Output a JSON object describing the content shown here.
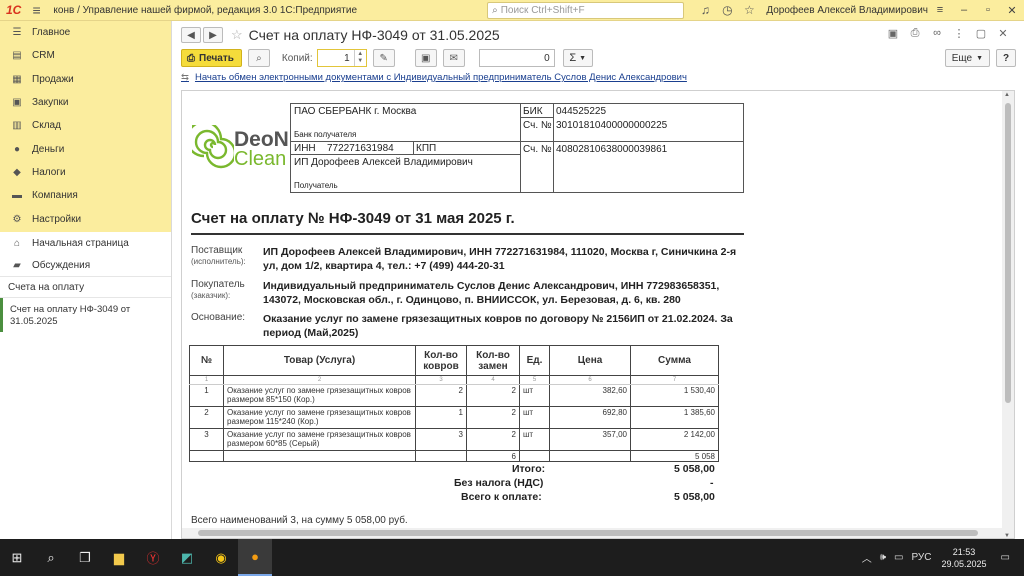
{
  "app": {
    "logo": "1С",
    "title": "конв / Управление нашей фирмой, редакция 3.0 1С:Предприятие",
    "search_placeholder": "Поиск Ctrl+Shift+F",
    "user": "Дорофеев Алексей Владимирович"
  },
  "sidebar": {
    "sections": [
      {
        "label": "Главное",
        "icon": "menu-icon"
      },
      {
        "label": "CRM",
        "icon": "crm-icon"
      },
      {
        "label": "Продажи",
        "icon": "sales-icon"
      },
      {
        "label": "Закупки",
        "icon": "purchases-icon"
      },
      {
        "label": "Склад",
        "icon": "warehouse-icon"
      },
      {
        "label": "Деньги",
        "icon": "money-icon"
      },
      {
        "label": "Налоги",
        "icon": "taxes-icon"
      },
      {
        "label": "Компания",
        "icon": "company-icon"
      },
      {
        "label": "Настройки",
        "icon": "settings-icon"
      }
    ],
    "home": "Начальная страница",
    "discussions": "Обсуждения",
    "group": "Счета на оплату",
    "open_doc": "Счет на оплату НФ-3049 от 31.05.2025"
  },
  "header": {
    "doc_title": "Счет на оплату НФ-3049 от 31.05.2025"
  },
  "toolbar": {
    "print_label": "Печать",
    "copies_label": "Копий:",
    "copies_value": "1",
    "number_value": "0",
    "sigma_label": "Σ",
    "more_label": "Еще",
    "help_label": "?"
  },
  "edo_link": "Начать обмен электронными документами с Индивидуальный предприниматель Суслов Денис Александрович",
  "logo": {
    "line1": "DeoN",
    "line2": "Clean"
  },
  "bank": {
    "bank_name": "ПАО СБЕРБАНК г. Москва",
    "bank_caption": "Банк получателя",
    "bik_label": "БИК",
    "bik_value": "044525225",
    "acc_label": "Сч. №",
    "corr_acc": "30101810400000000225",
    "inn_label": "ИНН",
    "inn_value": "772271631984",
    "kpp_label": "КПП",
    "recipient_name": "ИП Дорофеев Алексей Владимирович",
    "recipient_caption": "Получатель",
    "acc_label2": "Сч. №",
    "recipient_acc": "40802810638000039861"
  },
  "invoice_title": "Счет на оплату № НФ-3049 от 31 мая 2025 г.",
  "supplier": {
    "label": "Поставщик",
    "sub": "(исполнитель):",
    "value": "ИП Дорофеев Алексей Владимирович, ИНН 772271631984, 111020, Москва г, Синичкина 2-я ул, дом 1/2, квартира 4, тел.: +7 (499) 444-20-31"
  },
  "buyer": {
    "label": "Покупатель",
    "sub": "(заказчик):",
    "value": "Индивидуальный предприниматель Суслов Денис Александрович, ИНН 772983658351, 143072, Московская обл., г. Одинцово, п. ВНИИССОК, ул. Березовая, д. 6, кв. 280"
  },
  "basis": {
    "label": "Основание:",
    "value": "Оказание услуг по замене грязезащитных ковров по договору № 2156ИП от 21.02.2024. За период (Май,2025)"
  },
  "table": {
    "headers": [
      "№",
      "Товар (Услуга)",
      "Кол-во ковров",
      "Кол-во замен",
      "Ед.",
      "Цена",
      "Сумма"
    ],
    "col_numbers": [
      "1",
      "2",
      "3",
      "4",
      "5",
      "6",
      "7"
    ],
    "rows": [
      {
        "n": "1",
        "name": "Оказание услуг по замене грязезащитных ковров размером 85*150 (Кор.)",
        "qty": "2",
        "repl": "2",
        "unit": "шт",
        "price": "382,60",
        "sum": "1 530,40"
      },
      {
        "n": "2",
        "name": "Оказание услуг по замене грязезащитных ковров размером 115*240 (Кор.)",
        "qty": "1",
        "repl": "2",
        "unit": "шт",
        "price": "692,80",
        "sum": "1 385,60"
      },
      {
        "n": "3",
        "name": "Оказание услуг по замене грязезащитных ковров размером 60*85 (Серый)",
        "qty": "3",
        "repl": "2",
        "unit": "шт",
        "price": "357,00",
        "sum": "2 142,00"
      }
    ],
    "total_repl": "6",
    "total_sum": "5 058"
  },
  "totals": {
    "itogo_label": "Итого:",
    "itogo_value": "5 058,00",
    "nds_label": "Без налога (НДС)",
    "nds_value": "-",
    "pay_label": "Всего к оплате:",
    "pay_value": "5 058,00"
  },
  "footer": "Всего наименований 3, на сумму 5 058,00 руб.",
  "taskbar": {
    "lang": "РУС",
    "time": "21:53",
    "date": "29.05.2025"
  }
}
